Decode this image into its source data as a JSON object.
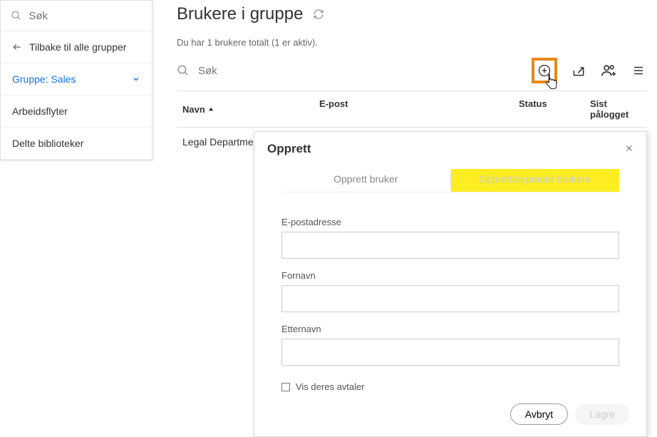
{
  "sidebar": {
    "search_placeholder": "Søk",
    "back_label": "Tilbake til alle grupper",
    "group_label": "Gruppe: Sales",
    "workflows_label": "Arbeidsflyter",
    "libraries_label": "Delte biblioteker"
  },
  "page": {
    "title": "Brukere i gruppe",
    "count_text": "Du har 1 brukere totalt (1 er aktiv).",
    "table_search_placeholder": "Søk"
  },
  "table": {
    "headers": {
      "name": "Navn",
      "email": "E-post",
      "status": "Status",
      "last_login": "Sist pålogget"
    },
    "rows": [
      {
        "name": "Legal Departmen"
      }
    ]
  },
  "modal": {
    "title": "Opprett",
    "tab_create": "Opprett bruker",
    "tab_update": "Opprett/oppdater brukere",
    "label_email": "E-postadresse",
    "label_firstname": "Fornavn",
    "label_lastname": "Etternavn",
    "checkbox_label": "Vis deres avtaler",
    "btn_cancel": "Avbryt",
    "btn_save": "Lagre"
  }
}
